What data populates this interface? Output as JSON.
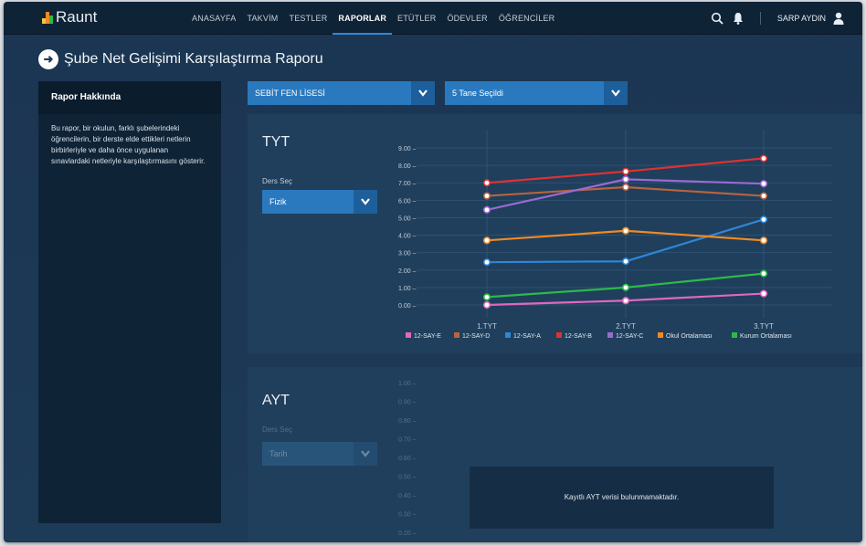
{
  "app": {
    "logo": "Raunt"
  },
  "nav": {
    "items": [
      {
        "label": "ANASAYFA",
        "active": false
      },
      {
        "label": "TAKVİM",
        "active": false
      },
      {
        "label": "TESTLER",
        "active": false
      },
      {
        "label": "RAPORLAR",
        "active": true
      },
      {
        "label": "ETÜTLER",
        "active": false
      },
      {
        "label": "ÖDEVLER",
        "active": false
      },
      {
        "label": "ÖĞRENCİLER",
        "active": false
      }
    ],
    "user": "SARP AYDIN"
  },
  "page": {
    "title": "Şube Net Gelişimi Karşılaştırma Raporu"
  },
  "about": {
    "heading": "Rapor Hakkında",
    "text": "Bu rapor, bir okulun, farklı şubelerindeki öğrencilerin, bir derste elde ettikleri netlerin birbirleriyle ve daha önce uygulanan sınavlardaki netleriyle karşılaştırmasını gösterir."
  },
  "filters": {
    "school": "SEBİT FEN LİSESİ",
    "selection": "5 Tane Seçildi"
  },
  "tyt": {
    "title": "TYT",
    "ders_label": "Ders Seç",
    "ders_value": "Fizik"
  },
  "ayt": {
    "title": "AYT",
    "ders_label": "Ders Seç",
    "ders_value": "Tarih",
    "no_data": "Kayıtlı AYT verisi bulunmamaktadır."
  },
  "chart_data": [
    {
      "type": "line",
      "title": "TYT",
      "categories": [
        "1.TYT",
        "2.TYT",
        "3.TYT"
      ],
      "ylim": [
        0,
        9
      ],
      "yticks": [
        "0.00",
        "1.00",
        "2.00",
        "3.00",
        "4.00",
        "5.00",
        "6.00",
        "7.00",
        "8.00",
        "9.00"
      ],
      "grid": true,
      "legend_position": "bottom",
      "series": [
        {
          "name": "12-SAY-E",
          "color": "#e067c0",
          "values": [
            0.0,
            0.25,
            0.65
          ]
        },
        {
          "name": "12-SAY-D",
          "color": "#b5643f",
          "values": [
            6.25,
            6.75,
            6.25
          ]
        },
        {
          "name": "12-SAY-A",
          "color": "#2f86d6",
          "values": [
            2.45,
            2.5,
            4.9
          ]
        },
        {
          "name": "12-SAY-B",
          "color": "#e03131",
          "values": [
            7.0,
            7.65,
            8.4
          ]
        },
        {
          "name": "12-SAY-C",
          "color": "#9b6ad1",
          "values": [
            5.45,
            7.2,
            6.95
          ]
        },
        {
          "name": "Okul Ortalaması",
          "color": "#f08a24",
          "values": [
            3.7,
            4.25,
            3.7
          ]
        },
        {
          "name": "Kurum Ortalaması",
          "color": "#2eb84b",
          "values": [
            0.45,
            1.0,
            1.8
          ]
        }
      ]
    },
    {
      "type": "line",
      "title": "AYT",
      "ylim": [
        0,
        1
      ],
      "yticks": [
        "0.20",
        "0.30",
        "0.40",
        "0.50",
        "0.60",
        "0.70",
        "0.80",
        "0.90",
        "1.00"
      ],
      "series": []
    }
  ]
}
